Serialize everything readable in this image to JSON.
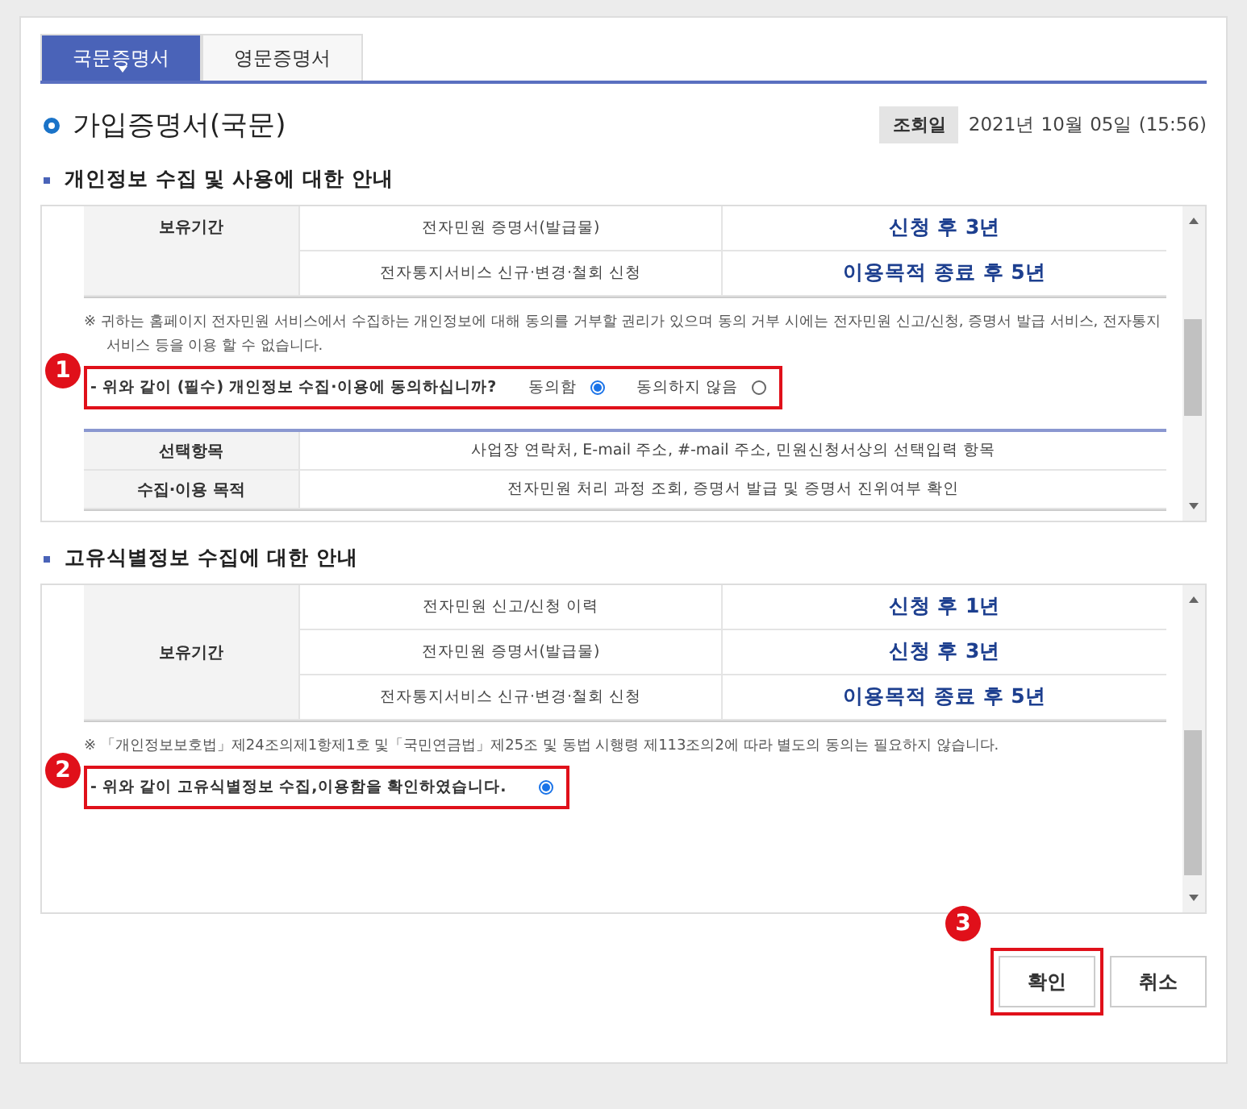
{
  "tabs": [
    {
      "label": "국문증명서",
      "selected": true
    },
    {
      "label": "영문증명서",
      "selected": false
    }
  ],
  "title": "가입증명서(국문)",
  "lookup": {
    "label": "조회일",
    "value": "2021년 10월 05일 (15:56)"
  },
  "sections": [
    {
      "heading": "개인정보 수집 및 사용에 대한 안내",
      "retention": {
        "label": "보유기간",
        "rows": [
          {
            "item": "전자민원 증명서(발급물)",
            "period": "신청 후 3년"
          },
          {
            "item": "전자통지서비스 신규·변경·철회 신청",
            "period": "이용목적 종료 후 5년"
          }
        ]
      },
      "note": "※ 귀하는 홈페이지 전자민원 서비스에서 수집하는 개인정보에 대해 동의를 거부할 권리가 있으며 동의 거부 시에는 전자민원 신고/신청, 증명서 발급 서비스, 전자통지서비스 등을 이용 할 수 없습니다.",
      "badge": "1",
      "question": "- 위와 같이 (필수) 개인정보 수집·이용에 동의하십니까?",
      "options": [
        {
          "label": "동의함",
          "selected": true
        },
        {
          "label": "동의하지 않음",
          "selected": false
        }
      ],
      "extra_rows": [
        {
          "label": "선택항목",
          "value": "사업장 연락처, E-mail 주소, #-mail 주소, 민원신청서상의 선택입력 항목"
        },
        {
          "label": "수집·이용 목적",
          "value": "전자민원 처리 과정 조회, 증명서 발급 및 증명서 진위여부 확인"
        }
      ]
    },
    {
      "heading": "고유식별정보 수집에 대한 안내",
      "retention": {
        "label": "보유기간",
        "rows": [
          {
            "item": "전자민원 신고/신청 이력",
            "period": "신청 후 1년"
          },
          {
            "item": "전자민원 증명서(발급물)",
            "period": "신청 후 3년"
          },
          {
            "item": "전자통지서비스 신규·변경·철회 신청",
            "period": "이용목적 종료 후 5년"
          }
        ]
      },
      "note": "※ 「개인정보보호법」제24조의제1항제1호 및「국민연금법」제25조 및 동법 시행령 제113조의2에 따라 별도의 동의는 필요하지 않습니다.",
      "badge": "2",
      "question": "- 위와 같이 고유식별정보 수집,이용함을 확인하였습니다.",
      "options": [
        {
          "selected": true
        }
      ]
    }
  ],
  "buttons": [
    {
      "label": "확인",
      "badge": "3"
    },
    {
      "label": "취소"
    }
  ]
}
